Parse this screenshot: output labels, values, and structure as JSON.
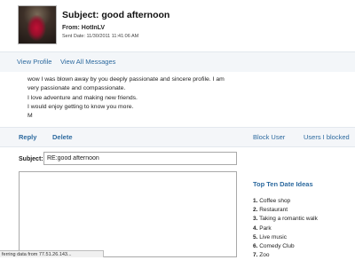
{
  "message": {
    "subject_title": "Subject: good afternoon",
    "from_label": "From:",
    "from_name": "HotInLV",
    "sent_label": "Sent Date:",
    "sent_date": "11/30/2011 11:41:06 AM",
    "body_lines": [
      "wow I was blown away by you deeply passionate and sincere profile. I am",
      "very passionate and compassionate.",
      "I love adventure and making new friends.",
      "I would enjoy getting to know you more.",
      "M"
    ]
  },
  "nav": {
    "view_profile": "View Profile",
    "view_all_messages": "View All Messages"
  },
  "actions": {
    "reply": "Reply",
    "delete": "Delete",
    "block_user": "Block User",
    "users_blocked": "Users I blocked"
  },
  "reply_form": {
    "subject_label": "Subject:",
    "subject_value": "RE:good afternoon",
    "body_value": ""
  },
  "date_ideas": {
    "title": "Top Ten Date Ideas",
    "items": [
      {
        "num": "1.",
        "text": "Coffee shop"
      },
      {
        "num": "2.",
        "text": "Restaurant"
      },
      {
        "num": "3.",
        "text": "Taking a romantic walk"
      },
      {
        "num": "4.",
        "text": "Park"
      },
      {
        "num": "5.",
        "text": "Live music"
      },
      {
        "num": "6.",
        "text": "Comedy Club"
      },
      {
        "num": "7.",
        "text": "Zoo"
      }
    ]
  },
  "status_bar": {
    "text": "ferring data from 77.51.26.143..."
  },
  "colors": {
    "link": "#2d6a9f",
    "bar_background": "#f3f6f9"
  }
}
